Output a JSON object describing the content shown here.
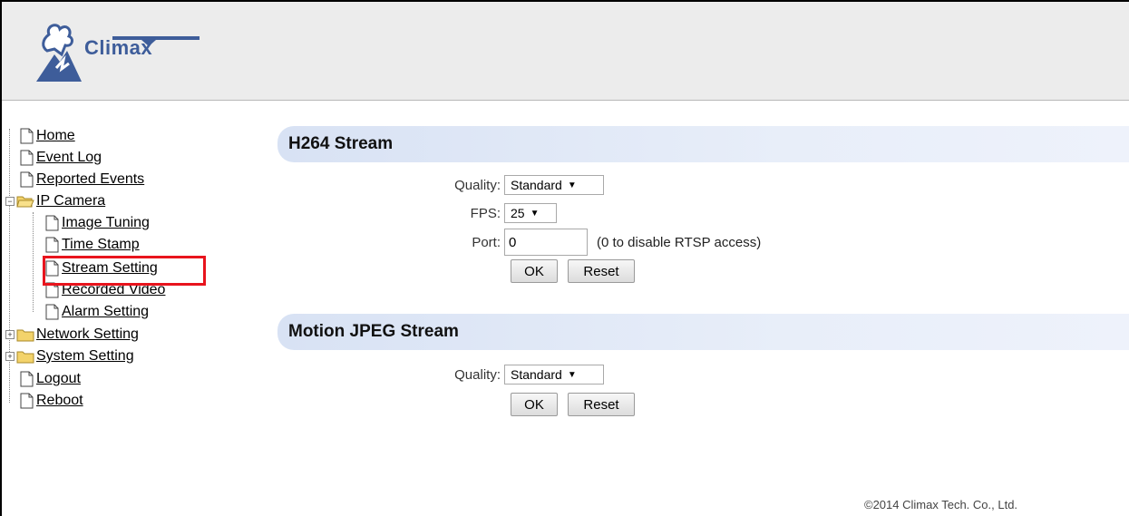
{
  "brand": {
    "name": "Climax"
  },
  "menu": {
    "home": "Home",
    "event_log": "Event Log",
    "reported_events": "Reported Events",
    "ip_camera": "IP Camera",
    "image_tuning": "Image Tuning",
    "time_stamp": "Time Stamp",
    "stream_setting": "Stream Setting",
    "recorded_video": "Recorded Video",
    "alarm_setting": "Alarm Setting",
    "network_setting": "Network Setting",
    "system_setting": "System Setting",
    "logout": "Logout",
    "reboot": "Reboot"
  },
  "h264": {
    "title": "H264 Stream",
    "quality_label": "Quality:",
    "quality_value": "Standard",
    "fps_label": "FPS:",
    "fps_value": "25",
    "port_label": "Port:",
    "port_value": "0",
    "port_hint": "(0 to disable RTSP access)",
    "ok": "OK",
    "reset": "Reset"
  },
  "mjpeg": {
    "title": "Motion JPEG Stream",
    "quality_label": "Quality:",
    "quality_value": "Standard",
    "ok": "OK",
    "reset": "Reset"
  },
  "footer": {
    "copyright": "©2014 Climax Tech. Co., Ltd."
  },
  "colors": {
    "highlight": "#e8141d",
    "section_bar": "#dde6f6",
    "logo": "#3e5d9a"
  },
  "icons": {
    "page": "page-icon",
    "folder": "folder-icon",
    "folder_open": "folder-open-icon"
  }
}
